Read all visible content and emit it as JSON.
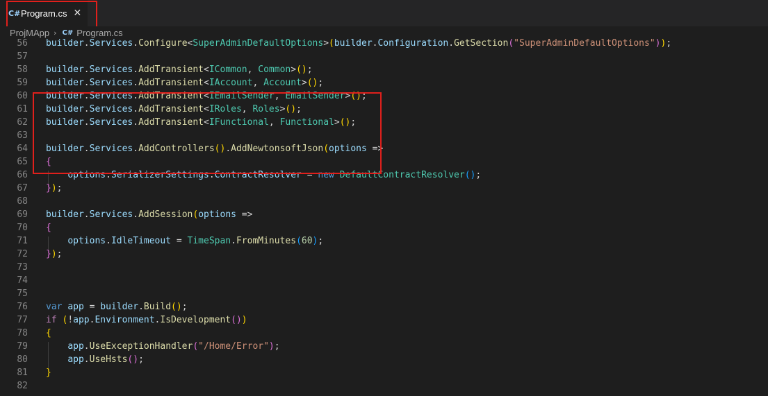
{
  "tab": {
    "icon": "csharp-icon",
    "title": "Program.cs",
    "close_glyph": "✕"
  },
  "breadcrumb": {
    "project": "ProjMApp",
    "separator": "›",
    "file": "Program.cs"
  },
  "colors": {
    "annotation": "#e0201c",
    "editor_bg": "#1e1e1e",
    "tab_bg": "#252526"
  },
  "lines": [
    {
      "n": "56",
      "tokens": [
        [
          "builder",
          "var"
        ],
        [
          ".",
          "op"
        ],
        [
          "Services",
          "var"
        ],
        [
          ".",
          "op"
        ],
        [
          "Configure",
          "fn"
        ],
        [
          "<",
          "op"
        ],
        [
          "SuperAdminDefaultOptions",
          "type"
        ],
        [
          ">",
          "op"
        ],
        [
          "(",
          "p1"
        ],
        [
          "builder",
          "var"
        ],
        [
          ".",
          "op"
        ],
        [
          "Configuration",
          "var"
        ],
        [
          ".",
          "op"
        ],
        [
          "GetSection",
          "fn"
        ],
        [
          "(",
          "p2"
        ],
        [
          "\"SuperAdminDefaultOptions\"",
          "str"
        ],
        [
          ")",
          "p2"
        ],
        [
          ")",
          "p1"
        ],
        [
          ";",
          "op"
        ]
      ]
    },
    {
      "n": "57",
      "tokens": []
    },
    {
      "n": "58",
      "tokens": [
        [
          "builder",
          "var"
        ],
        [
          ".",
          "op"
        ],
        [
          "Services",
          "var"
        ],
        [
          ".",
          "op"
        ],
        [
          "AddTransient",
          "fn"
        ],
        [
          "<",
          "op"
        ],
        [
          "ICommon",
          "type"
        ],
        [
          ", ",
          "op"
        ],
        [
          "Common",
          "type"
        ],
        [
          ">",
          "op"
        ],
        [
          "()",
          "p1"
        ],
        [
          ";",
          "op"
        ]
      ]
    },
    {
      "n": "59",
      "tokens": [
        [
          "builder",
          "var"
        ],
        [
          ".",
          "op"
        ],
        [
          "Services",
          "var"
        ],
        [
          ".",
          "op"
        ],
        [
          "AddTransient",
          "fn"
        ],
        [
          "<",
          "op"
        ],
        [
          "IAccount",
          "type"
        ],
        [
          ", ",
          "op"
        ],
        [
          "Account",
          "type"
        ],
        [
          ">",
          "op"
        ],
        [
          "()",
          "p1"
        ],
        [
          ";",
          "op"
        ]
      ]
    },
    {
      "n": "60",
      "tokens": [
        [
          "builder",
          "var"
        ],
        [
          ".",
          "op"
        ],
        [
          "Services",
          "var"
        ],
        [
          ".",
          "op"
        ],
        [
          "AddTransient",
          "fn"
        ],
        [
          "<",
          "op"
        ],
        [
          "IEmailSender",
          "type"
        ],
        [
          ", ",
          "op"
        ],
        [
          "EmailSender",
          "type"
        ],
        [
          ">",
          "op"
        ],
        [
          "()",
          "p1"
        ],
        [
          ";",
          "op"
        ]
      ]
    },
    {
      "n": "61",
      "tokens": [
        [
          "builder",
          "var"
        ],
        [
          ".",
          "op"
        ],
        [
          "Services",
          "var"
        ],
        [
          ".",
          "op"
        ],
        [
          "AddTransient",
          "fn"
        ],
        [
          "<",
          "op"
        ],
        [
          "IRoles",
          "type"
        ],
        [
          ", ",
          "op"
        ],
        [
          "Roles",
          "type"
        ],
        [
          ">",
          "op"
        ],
        [
          "()",
          "p1"
        ],
        [
          ";",
          "op"
        ]
      ]
    },
    {
      "n": "62",
      "tokens": [
        [
          "builder",
          "var"
        ],
        [
          ".",
          "op"
        ],
        [
          "Services",
          "var"
        ],
        [
          ".",
          "op"
        ],
        [
          "AddTransient",
          "fn"
        ],
        [
          "<",
          "op"
        ],
        [
          "IFunctional",
          "type"
        ],
        [
          ", ",
          "op"
        ],
        [
          "Functional",
          "type"
        ],
        [
          ">",
          "op"
        ],
        [
          "()",
          "p1"
        ],
        [
          ";",
          "op"
        ]
      ]
    },
    {
      "n": "63",
      "tokens": []
    },
    {
      "n": "64",
      "tokens": [
        [
          "builder",
          "var"
        ],
        [
          ".",
          "op"
        ],
        [
          "Services",
          "var"
        ],
        [
          ".",
          "op"
        ],
        [
          "AddControllers",
          "fn"
        ],
        [
          "()",
          "p1"
        ],
        [
          ".",
          "op"
        ],
        [
          "AddNewtonsoftJson",
          "fn"
        ],
        [
          "(",
          "p1"
        ],
        [
          "options",
          "var"
        ],
        [
          " =>",
          "op"
        ]
      ]
    },
    {
      "n": "65",
      "tokens": [
        [
          "{",
          "p2"
        ]
      ]
    },
    {
      "n": "66",
      "tokens": [
        [
          "    ",
          "op"
        ],
        [
          "options",
          "var"
        ],
        [
          ".",
          "op"
        ],
        [
          "SerializerSettings",
          "var"
        ],
        [
          ".",
          "op"
        ],
        [
          "ContractResolver",
          "var"
        ],
        [
          " = ",
          "op"
        ],
        [
          "new",
          "kw"
        ],
        [
          " ",
          "op"
        ],
        [
          "DefaultContractResolver",
          "type"
        ],
        [
          "()",
          "p3"
        ],
        [
          ";",
          "op"
        ]
      ]
    },
    {
      "n": "67",
      "tokens": [
        [
          "}",
          "p2"
        ],
        [
          ")",
          "p1"
        ],
        [
          ";",
          "op"
        ]
      ]
    },
    {
      "n": "68",
      "tokens": []
    },
    {
      "n": "69",
      "tokens": [
        [
          "builder",
          "var"
        ],
        [
          ".",
          "op"
        ],
        [
          "Services",
          "var"
        ],
        [
          ".",
          "op"
        ],
        [
          "AddSession",
          "fn"
        ],
        [
          "(",
          "p1"
        ],
        [
          "options",
          "var"
        ],
        [
          " =>",
          "op"
        ]
      ]
    },
    {
      "n": "70",
      "tokens": [
        [
          "{",
          "p2"
        ]
      ]
    },
    {
      "n": "71",
      "tokens": [
        [
          "    ",
          "op"
        ],
        [
          "options",
          "var"
        ],
        [
          ".",
          "op"
        ],
        [
          "IdleTimeout",
          "var"
        ],
        [
          " = ",
          "op"
        ],
        [
          "TimeSpan",
          "type"
        ],
        [
          ".",
          "op"
        ],
        [
          "FromMinutes",
          "fn"
        ],
        [
          "(",
          "p3"
        ],
        [
          "60",
          "num"
        ],
        [
          ")",
          "p3"
        ],
        [
          ";",
          "op"
        ]
      ]
    },
    {
      "n": "72",
      "tokens": [
        [
          "}",
          "p2"
        ],
        [
          ")",
          "p1"
        ],
        [
          ";",
          "op"
        ]
      ]
    },
    {
      "n": "73",
      "tokens": []
    },
    {
      "n": "74",
      "tokens": []
    },
    {
      "n": "75",
      "tokens": []
    },
    {
      "n": "76",
      "tokens": [
        [
          "var",
          "kw"
        ],
        [
          " ",
          "op"
        ],
        [
          "app",
          "var"
        ],
        [
          " = ",
          "op"
        ],
        [
          "builder",
          "var"
        ],
        [
          ".",
          "op"
        ],
        [
          "Build",
          "fn"
        ],
        [
          "()",
          "p1"
        ],
        [
          ";",
          "op"
        ]
      ]
    },
    {
      "n": "77",
      "tokens": [
        [
          "if",
          "ctl"
        ],
        [
          " ",
          "op"
        ],
        [
          "(",
          "p1"
        ],
        [
          "!",
          "op"
        ],
        [
          "app",
          "var"
        ],
        [
          ".",
          "op"
        ],
        [
          "Environment",
          "var"
        ],
        [
          ".",
          "op"
        ],
        [
          "IsDevelopment",
          "fn"
        ],
        [
          "()",
          "p2"
        ],
        [
          ")",
          "p1"
        ]
      ]
    },
    {
      "n": "78",
      "tokens": [
        [
          "{",
          "p1"
        ]
      ]
    },
    {
      "n": "79",
      "tokens": [
        [
          "    ",
          "op"
        ],
        [
          "app",
          "var"
        ],
        [
          ".",
          "op"
        ],
        [
          "UseExceptionHandler",
          "fn"
        ],
        [
          "(",
          "p2"
        ],
        [
          "\"/Home/Error\"",
          "str"
        ],
        [
          ")",
          "p2"
        ],
        [
          ";",
          "op"
        ]
      ]
    },
    {
      "n": "80",
      "tokens": [
        [
          "    ",
          "op"
        ],
        [
          "app",
          "var"
        ],
        [
          ".",
          "op"
        ],
        [
          "UseHsts",
          "fn"
        ],
        [
          "()",
          "p2"
        ],
        [
          ";",
          "op"
        ]
      ]
    },
    {
      "n": "81",
      "tokens": [
        [
          "}",
          "p1"
        ]
      ]
    },
    {
      "n": "82",
      "tokens": []
    }
  ]
}
